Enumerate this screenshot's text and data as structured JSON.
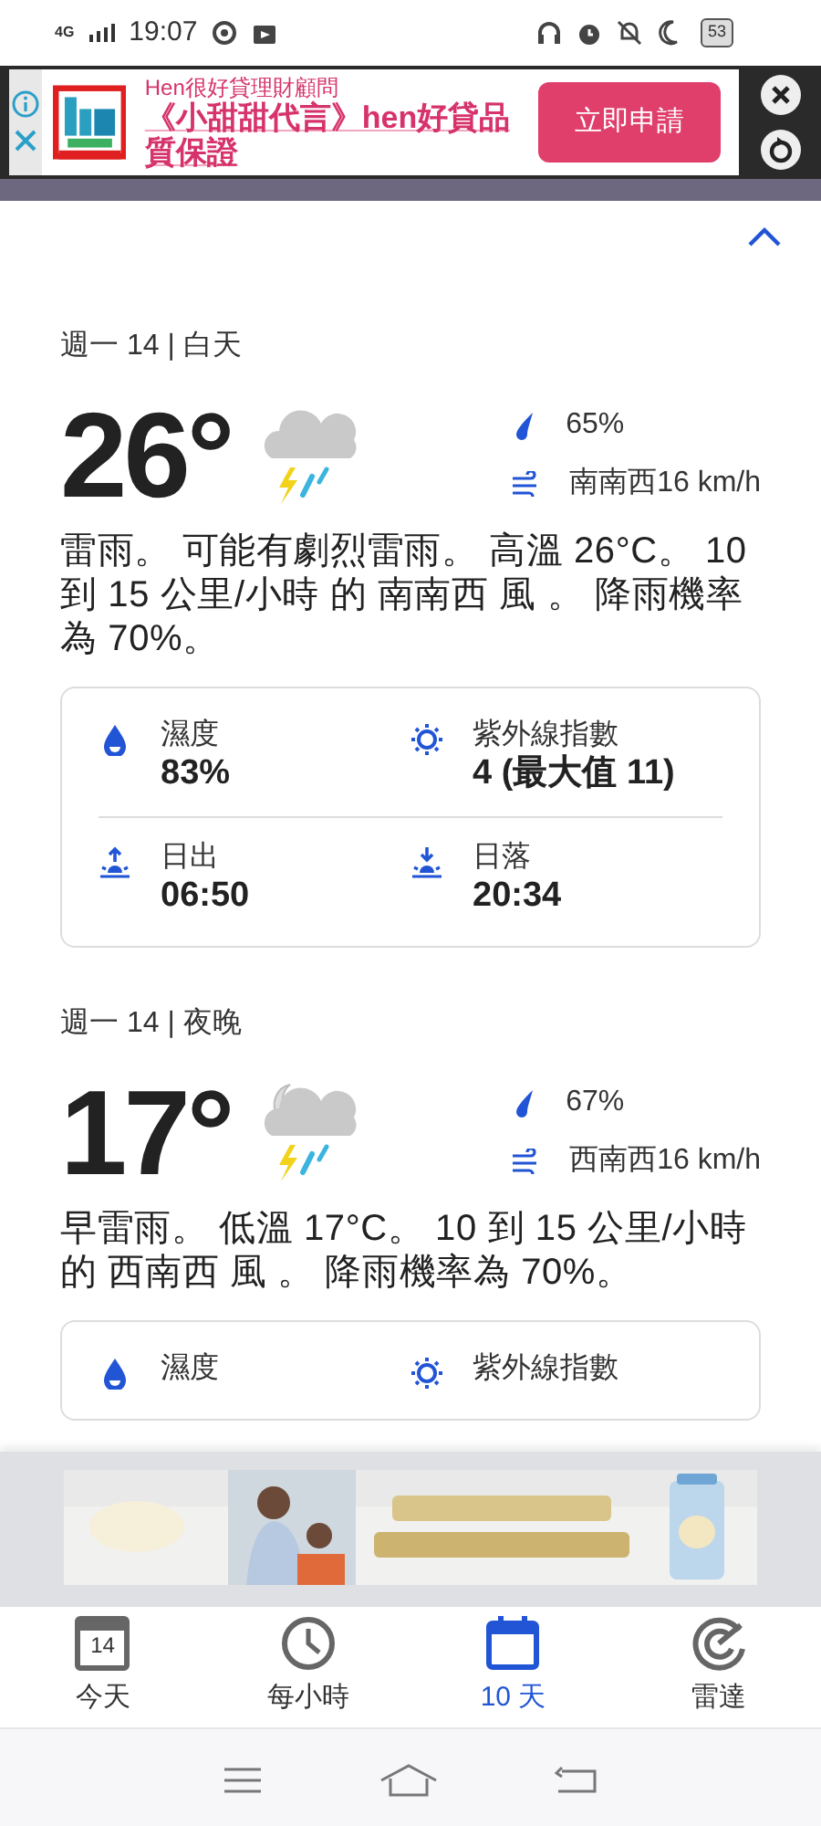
{
  "status_bar": {
    "network": "4G",
    "time": "19:07",
    "battery": "53"
  },
  "top_ad": {
    "advertiser": "Hen很好貸理財顧問",
    "headline": "《小甜甜代言》hen好貸品質保證",
    "button": "立即申請"
  },
  "periods": [
    {
      "heading": "週一 14 | 白天",
      "temperature": "26°",
      "kind": "day",
      "precipitation": "65%",
      "wind": "南南西16 km/h",
      "description": "雷雨。 可能有劇烈雷雨。 高溫 26°C。 10 到 15 公里/小時 的 南南西 風 。 降雨機率為 70%。",
      "details": [
        {
          "kind": "humidity",
          "label": "濕度",
          "value": "83%"
        },
        {
          "kind": "uv",
          "label": "紫外線指數",
          "value": "4 (最大值 11)"
        },
        {
          "kind": "sunrise",
          "label": "日出",
          "value": "06:50"
        },
        {
          "kind": "sunset",
          "label": "日落",
          "value": "20:34"
        }
      ]
    },
    {
      "heading": "週一 14 | 夜晚",
      "temperature": "17°",
      "kind": "night",
      "precipitation": "67%",
      "wind": "西南西16 km/h",
      "description": "早雷雨。 低溫 17°C。 10 到 15 公里/小時的 西南西 風 。 降雨機率為 70%。",
      "details": [
        {
          "kind": "humidity",
          "label": "濕度"
        },
        {
          "kind": "uv",
          "label": "紫外線指數"
        }
      ]
    }
  ],
  "bottom_nav": [
    {
      "kind": "today",
      "label": "今天",
      "icon_text": "14",
      "selected": false
    },
    {
      "kind": "hourly",
      "label": "每小時",
      "selected": false
    },
    {
      "kind": "ten_day",
      "label": "10 天",
      "selected": true
    },
    {
      "kind": "radar",
      "label": "雷達",
      "selected": false
    }
  ]
}
